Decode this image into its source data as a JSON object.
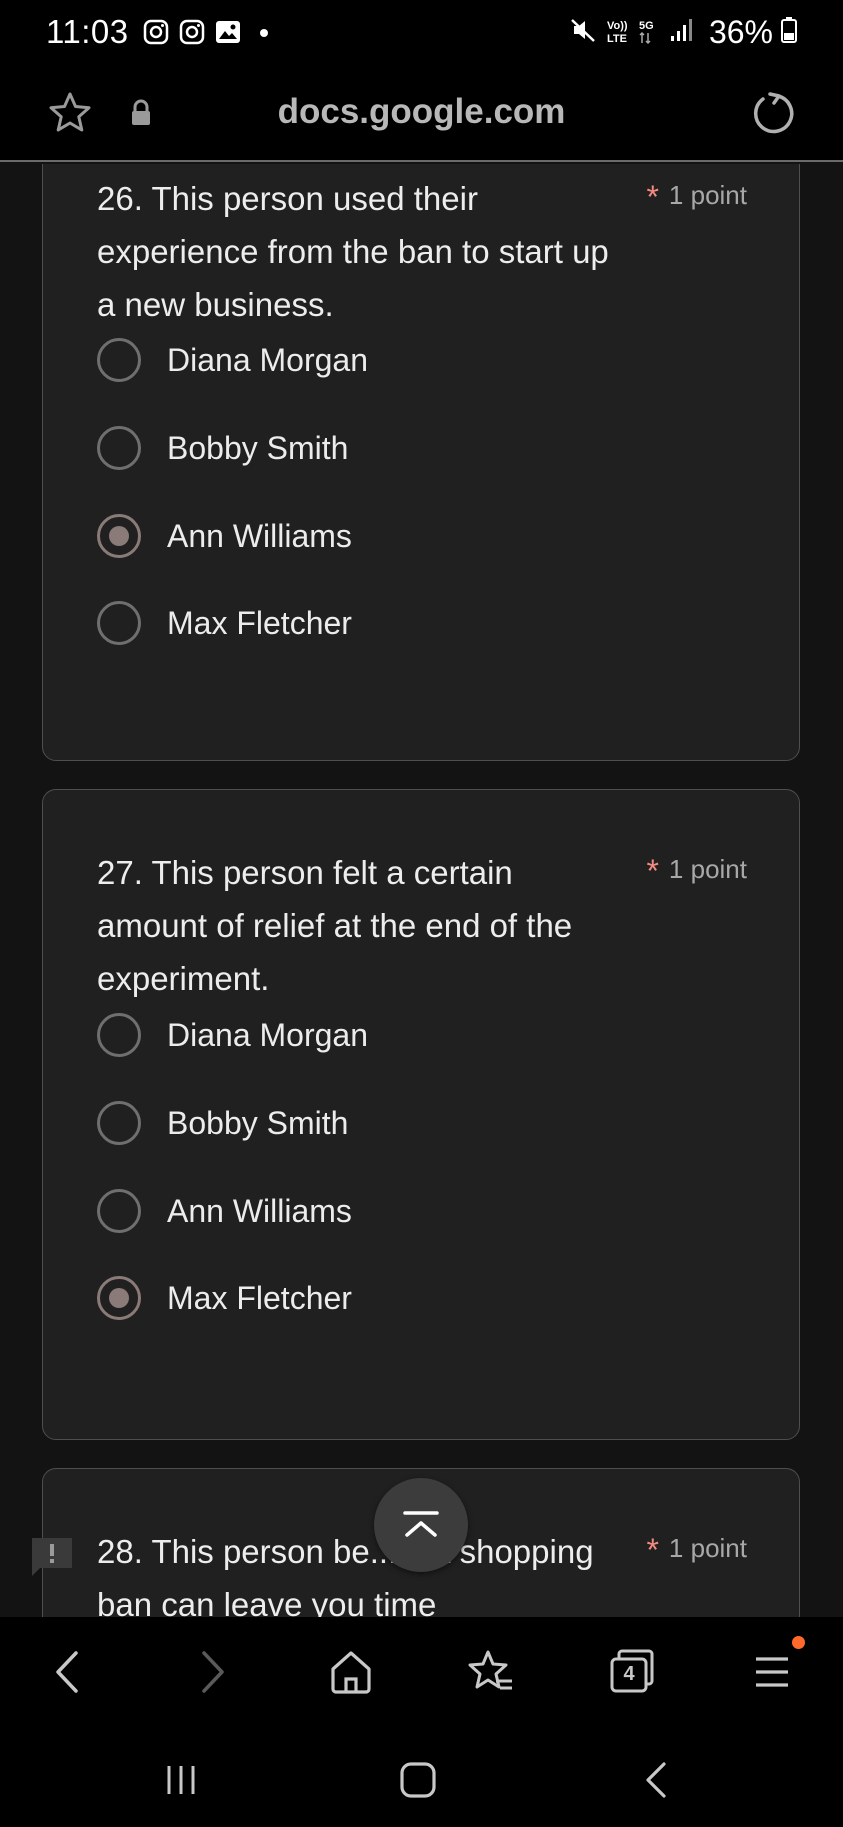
{
  "status": {
    "time": "11:03",
    "network": "VoLTE 5G",
    "battery": "36%"
  },
  "browser": {
    "domain": "docs.google.com",
    "tab_count": "4"
  },
  "questions": [
    {
      "title": "26. This person used their experience from the ban to start up a new business.",
      "points": "1 point",
      "options": [
        "Diana Morgan",
        "Bobby Smith",
        "Ann Williams",
        "Max Fletcher"
      ],
      "selected": "Ann Williams"
    },
    {
      "title": "27. This person felt a certain amount of relief at the end of the experiment.",
      "points": "1 point",
      "options": [
        "Diana Morgan",
        "Bobby Smith",
        "Ann Williams",
        "Max Fletcher"
      ],
      "selected": "Max Fletcher"
    },
    {
      "title": "28. This person be... s a shopping ban can leave you time",
      "points": "1 point"
    }
  ],
  "required_marker": "*",
  "colors": {
    "card_bg": "#202020",
    "required": "#f28b82",
    "menu_badge": "#ff6a2c"
  }
}
